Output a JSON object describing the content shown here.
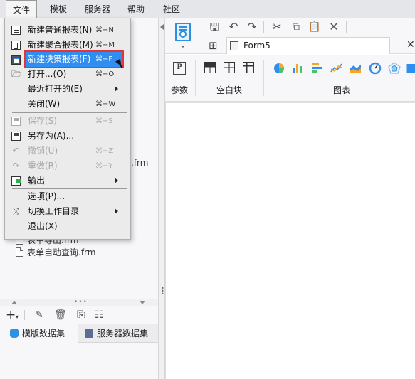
{
  "menubar": {
    "items": [
      "文件",
      "模板",
      "服务器",
      "帮助",
      "社区"
    ]
  },
  "file_menu": {
    "items": [
      {
        "label": "新建普通报表(N)",
        "shortcut": "⌘−N",
        "icon": "grid-report-icon",
        "disabled": false,
        "highlight": false
      },
      {
        "label": "新建聚合报表(M)",
        "shortcut": "⌘−M",
        "icon": "aggregate-report-icon",
        "disabled": false,
        "highlight": false
      },
      {
        "label": "新建决策报表(F)",
        "shortcut": "⌘−F",
        "icon": "decision-report-icon",
        "disabled": false,
        "highlight": true
      },
      {
        "label": "打开...(O)",
        "shortcut": "⌘−O",
        "icon": "folder-open-icon",
        "disabled": false,
        "highlight": false
      },
      {
        "label": "最近打开的(E)",
        "shortcut": "",
        "icon": "",
        "disabled": false,
        "highlight": false,
        "submenu": true
      },
      {
        "label": "关闭(W)",
        "shortcut": "⌘−W",
        "icon": "",
        "disabled": false,
        "highlight": false
      },
      {
        "label": "保存(S)",
        "shortcut": "⌘−S",
        "icon": "save-icon",
        "disabled": true,
        "highlight": false
      },
      {
        "label": "另存为(A)...",
        "shortcut": "",
        "icon": "save-as-icon",
        "disabled": false,
        "highlight": false
      },
      {
        "label": "撤销(U)",
        "shortcut": "⌘−Z",
        "icon": "undo-icon",
        "disabled": true,
        "highlight": false
      },
      {
        "label": "重做(R)",
        "shortcut": "⌘−Y",
        "icon": "redo-icon",
        "disabled": true,
        "highlight": false
      },
      {
        "label": "输出",
        "shortcut": "",
        "icon": "export-icon",
        "disabled": false,
        "highlight": false,
        "submenu": true
      },
      {
        "label": "选项(P)...",
        "shortcut": "",
        "icon": "",
        "disabled": false,
        "highlight": false
      },
      {
        "label": "切换工作目录",
        "shortcut": "",
        "icon": "shuffle-icon",
        "disabled": false,
        "highlight": false,
        "submenu": true
      },
      {
        "label": "退出(X)",
        "shortcut": "",
        "icon": "",
        "disabled": false,
        "highlight": false
      }
    ]
  },
  "file_tree": {
    "partial_suffix": ".frm",
    "files": [
      "表单导出.frm",
      "表单自动查询.frm"
    ]
  },
  "datasets": {
    "tabs": [
      "模版数据集",
      "服务器数据集"
    ]
  },
  "editor": {
    "tab_label": "Form5",
    "close_symbol": "✕",
    "sections": {
      "param_label": "参数",
      "blank_block_label": "空白块",
      "chart_label": "图表"
    }
  },
  "colors": {
    "highlight": "#2f8ef0",
    "highlight_border": "#e0353a",
    "accent_blue": "#2d8fe0"
  }
}
